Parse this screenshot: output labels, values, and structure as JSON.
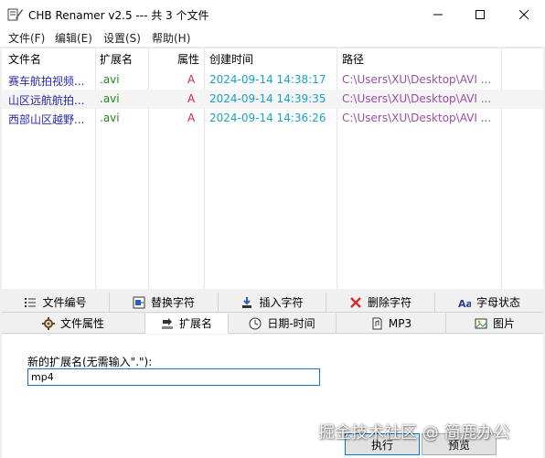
{
  "window": {
    "title": "CHB Renamer v2.5 --- 共 3 个文件"
  },
  "menu": [
    "文件(F)",
    "编辑(E)",
    "设置(S)",
    "帮助(H)"
  ],
  "list": {
    "columns": [
      "文件名",
      "扩展名",
      "属性",
      "创建时间",
      "路径"
    ],
    "rows": [
      {
        "name": "赛车航拍视频...",
        "ext": ".avi",
        "attr": "A",
        "created": "2024-09-14 14:38:17",
        "path": "C:\\Users\\XU\\Desktop\\AVI ..."
      },
      {
        "name": "山区远航航拍...",
        "ext": ".avi",
        "attr": "A",
        "created": "2024-09-14 14:39:35",
        "path": "C:\\Users\\XU\\Desktop\\AVI ..."
      },
      {
        "name": "西部山区越野...",
        "ext": ".avi",
        "attr": "A",
        "created": "2024-09-14 14:36:26",
        "path": "C:\\Users\\XU\\Desktop\\AVI ..."
      }
    ]
  },
  "tabs_row1": [
    {
      "label": "文件编号",
      "icon": "list-icon"
    },
    {
      "label": "替换字符",
      "icon": "replace-icon"
    },
    {
      "label": "插入字符",
      "icon": "insert-icon"
    },
    {
      "label": "删除字符",
      "icon": "delete-icon"
    },
    {
      "label": "字母状态",
      "icon": "letter-case-icon"
    }
  ],
  "tabs_row2": [
    {
      "label": "文件属性",
      "icon": "attributes-icon"
    },
    {
      "label": "扩展名",
      "icon": "extension-icon",
      "active": true
    },
    {
      "label": "日期-时间",
      "icon": "clock-icon"
    },
    {
      "label": "MP3",
      "icon": "mp3-icon"
    },
    {
      "label": "图片",
      "icon": "image-icon"
    }
  ],
  "extension_panel": {
    "label": "新的扩展名(无需输入\".\"):",
    "value": "mp4"
  },
  "buttons": {
    "run": "执行",
    "preview": "预览"
  },
  "watermark": "掘金技术社区 @ 简鹿办公"
}
